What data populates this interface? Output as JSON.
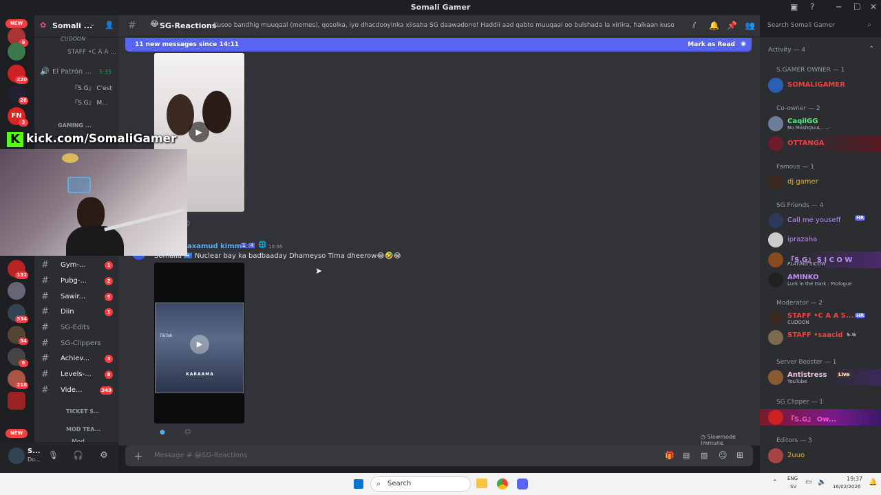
{
  "window": {
    "title": "Somali Gamer"
  },
  "server": {
    "name": "Somali ..."
  },
  "rail": {
    "new_top": "NEW",
    "new_bottom": "NEW",
    "badges": [
      "9",
      "220",
      "28",
      "3",
      "131",
      "334",
      "34",
      "6",
      "218"
    ]
  },
  "overlay": {
    "kick_letter": "K",
    "kick_url": "kick.com/SomaliGamer"
  },
  "sidebar": {
    "voice_users_top": [
      "CUDOON",
      "STAFF •C A A ..."
    ],
    "voice_channel": {
      "name": "El Patrón ...",
      "time": "5:35"
    },
    "voice_users": [
      "『S.G』 C'est",
      "『S.G』 M..."
    ],
    "category_gaming": "GAMING ...",
    "channels": [
      {
        "name": "Gym-...",
        "count": "1",
        "emoji": "💪"
      },
      {
        "name": "Pubg-...",
        "count": "2",
        "emoji": "🎮"
      },
      {
        "name": "Sawir...",
        "count": "5",
        "emoji": "📷"
      },
      {
        "name": "Diin",
        "count": "1",
        "emoji": "🕌"
      },
      {
        "name": "SG-Edits",
        "count": "",
        "emoji": ""
      },
      {
        "name": "SG-Clippers",
        "count": "",
        "emoji": ""
      },
      {
        "name": "Achiev...",
        "count": "3",
        "emoji": "⚠"
      },
      {
        "name": "Levels-...",
        "count": "8",
        "emoji": "⬆"
      },
      {
        "name": "Vide...",
        "count": "349",
        "emoji": "🎬"
      }
    ],
    "category_ticket": "TICKET S...",
    "category_mod": "MOD TEA...",
    "last_channel": "Mod...",
    "user": {
      "name": "S...",
      "status": "Do..."
    }
  },
  "header": {
    "channel": "SG-Reactions",
    "topic": "Kusoo bandhig muuqaal (memes), qosolka, iyo dhacdooyinka xiisaha SG daawadono! Haddii aad qabto muuqaal oo bulshada la xiriira, halkaan kusoo qor oo nala qosol.",
    "search_placeholder": "Search Somali Gamer"
  },
  "new_messages": {
    "text": "11 new messages since 14:11",
    "mark_read": "Mark as Read"
  },
  "message": {
    "author": "axamud kimmich",
    "author_tags": [
      "1",
      "4"
    ],
    "time": "10:56",
    "text": "Somalia 🇸🇴 Nuclear bay ka badbaaday Dhameyso Tima dheerow😂🤣😂",
    "video_caption": "KARAAMA",
    "tiktok_label": "TikTok"
  },
  "slowmode": "Slowmode Immune",
  "composer": {
    "placeholder": "Message #  😀SG-Reactions"
  },
  "members": {
    "activity": "Activity — 4",
    "groups": [
      {
        "role": "S.GAMER OWNER — 1",
        "users": [
          {
            "name": "SOMALIGAMER",
            "status": "",
            "color": "#f23f43"
          }
        ]
      },
      {
        "role": "Co-owner — 2",
        "users": [
          {
            "name": "CaqilGG",
            "status": "No MashQuuL......",
            "color": "#57f287"
          },
          {
            "name": "OTTANGA",
            "status": "",
            "color": "#f23f43"
          }
        ]
      },
      {
        "role": "Famous — 1",
        "users": [
          {
            "name": "dj gamer",
            "status": "",
            "color": "#f0b232"
          }
        ]
      },
      {
        "role": "SG Friends — 4",
        "users": [
          {
            "name": "Call me youseff",
            "status": "",
            "color": "#c38bff"
          },
          {
            "name": "iprazaha",
            "status": "",
            "color": "#c38bff"
          },
          {
            "name": "『S.G』 S I C O W",
            "status": "PLAYING SICOW",
            "color": "#c38bff"
          },
          {
            "name": "AMINKO",
            "status": "Lurk in the Dark : Prologue",
            "color": "#c38bff"
          }
        ]
      },
      {
        "role": "Moderator — 2",
        "users": [
          {
            "name": "STAFF •C A A S...",
            "status": "CUDOON",
            "color": "#f23f43"
          },
          {
            "name": "STAFF •saacid",
            "status": "",
            "color": "#f23f43"
          }
        ]
      },
      {
        "role": "Server Booster — 1",
        "users": [
          {
            "name": "Antistress",
            "status": "YouTube",
            "color": "#f5c2e7"
          }
        ]
      },
      {
        "role": "SG Clipper — 1",
        "users": [
          {
            "name": "『S.G』 Ow...",
            "status": "",
            "color": "#ff4fd8"
          }
        ]
      },
      {
        "role": "Editors — 3",
        "users": [
          {
            "name": "2uuo",
            "status": "",
            "color": "#f0b232"
          }
        ]
      }
    ],
    "tag_hr": "HR",
    "tag_live": "Live",
    "tag_sg": "S.G"
  },
  "taskbar": {
    "search": "Search",
    "lang": "ENG",
    "lang2": "SV",
    "time": "19:37",
    "date": "16/02/2026"
  }
}
